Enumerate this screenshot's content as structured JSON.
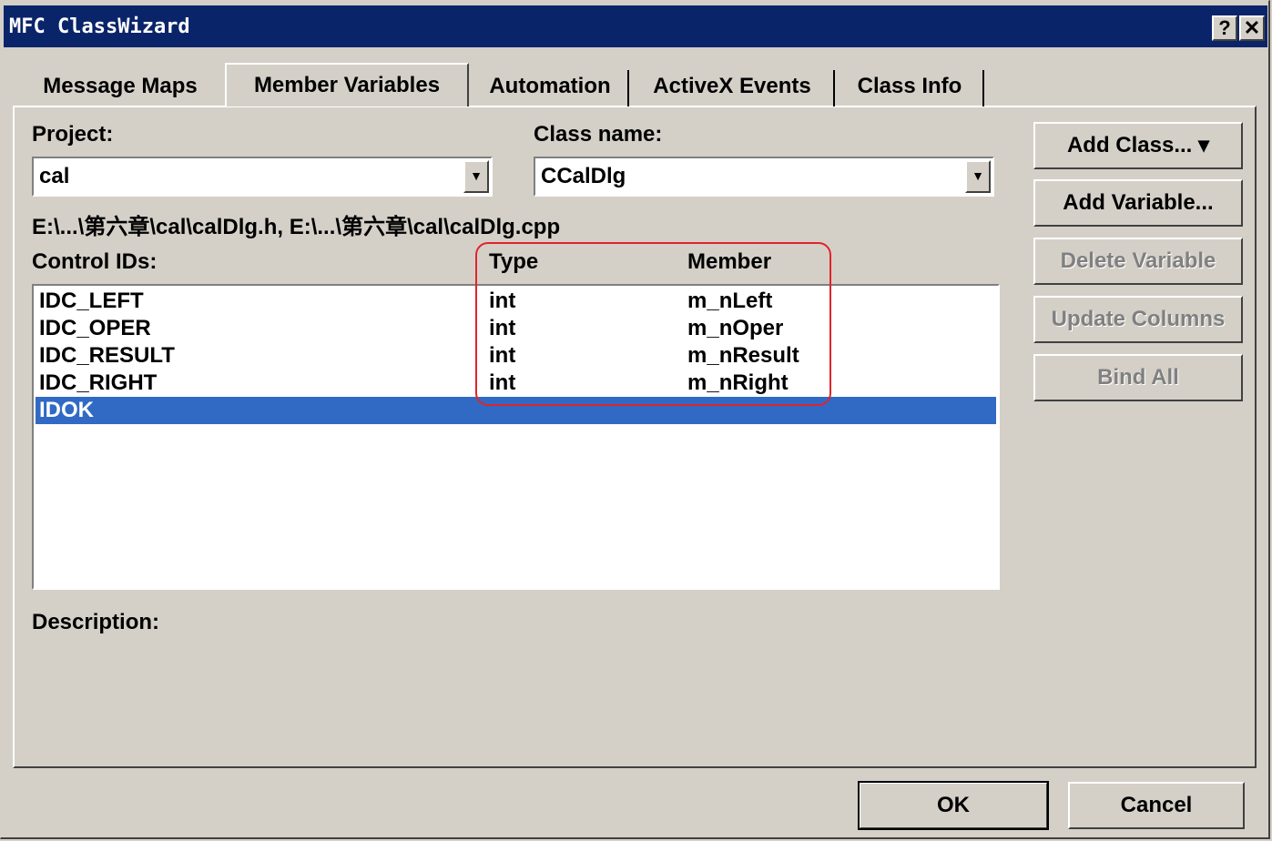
{
  "window": {
    "title": "MFC ClassWizard",
    "help_label": "?",
    "close_label": "✕"
  },
  "tabs": [
    {
      "label": "Message Maps"
    },
    {
      "label": "Member Variables"
    },
    {
      "label": "Automation"
    },
    {
      "label": "ActiveX Events"
    },
    {
      "label": "Class Info"
    }
  ],
  "project": {
    "label": "Project:",
    "value": "cal"
  },
  "class_name": {
    "label": "Class name:",
    "value": "CCalDlg"
  },
  "files_path": "E:\\...\\第六章\\cal\\calDlg.h, E:\\...\\第六章\\cal\\calDlg.cpp",
  "list": {
    "headers": {
      "control_ids": "Control IDs:",
      "type": "Type",
      "member": "Member"
    },
    "rows": [
      {
        "id": "IDC_LEFT",
        "type": "int",
        "member": "m_nLeft"
      },
      {
        "id": "IDC_OPER",
        "type": "int",
        "member": "m_nOper"
      },
      {
        "id": "IDC_RESULT",
        "type": "int",
        "member": "m_nResult"
      },
      {
        "id": "IDC_RIGHT",
        "type": "int",
        "member": "m_nRight"
      },
      {
        "id": "IDOK",
        "type": "",
        "member": "",
        "selected": true
      }
    ]
  },
  "description_label": "Description:",
  "side_buttons": {
    "add_class": "Add Class...  ▾",
    "add_variable": "Add Variable...",
    "delete_variable": "Delete Variable",
    "update_columns": "Update Columns",
    "bind_all": "Bind All"
  },
  "footer_buttons": {
    "ok": "OK",
    "cancel": "Cancel"
  },
  "colors": {
    "title_bar": "#0a246a",
    "selection": "#316ac5",
    "highlight_annotation": "#e0242b"
  }
}
